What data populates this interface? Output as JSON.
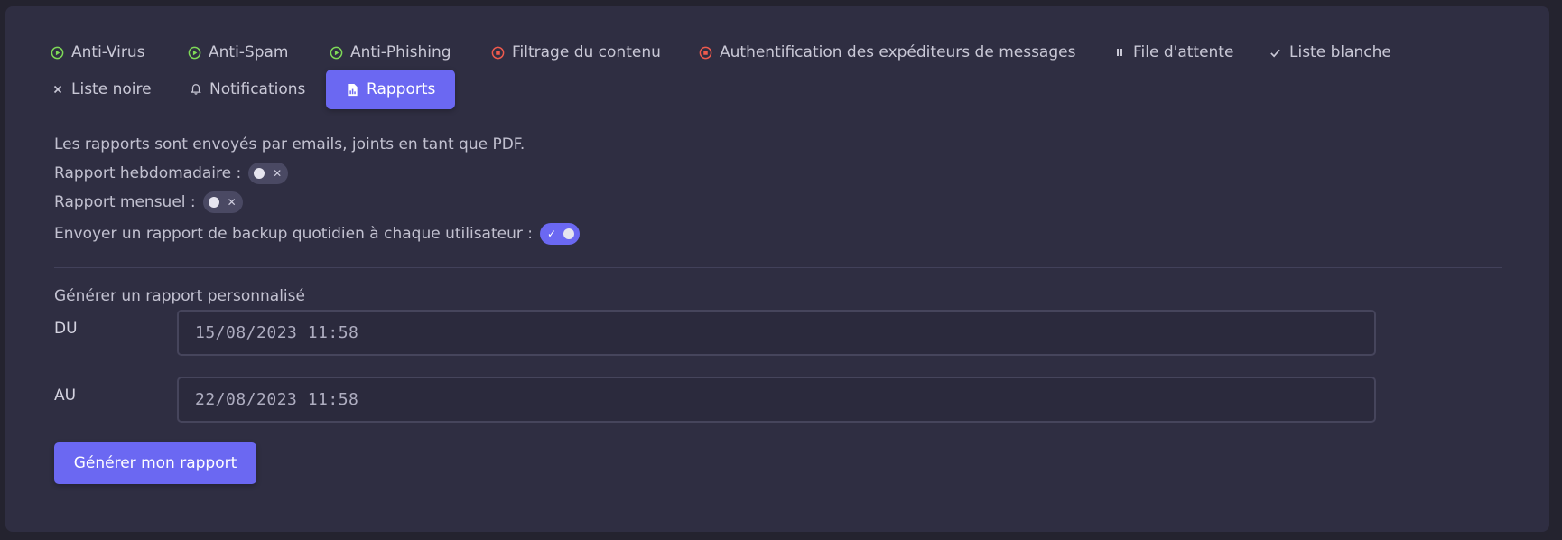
{
  "colors": {
    "accent": "#6b68f2",
    "active_green": "#7ed957",
    "error_red": "#ef5a4d"
  },
  "tabs": {
    "row1": [
      {
        "label": "Anti-Virus",
        "icon": "play-circle-icon"
      },
      {
        "label": "Anti-Spam",
        "icon": "play-circle-icon"
      },
      {
        "label": "Anti-Phishing",
        "icon": "play-circle-icon"
      },
      {
        "label": "Filtrage du contenu",
        "icon": "stop-circle-icon"
      },
      {
        "label": "Authentification des expéditeurs de messages",
        "icon": "stop-circle-icon"
      },
      {
        "label": "File d'attente",
        "icon": "pause-icon"
      },
      {
        "label": "Liste blanche",
        "icon": "check-icon"
      }
    ],
    "row2": [
      {
        "label": "Liste noire",
        "icon": "close-icon"
      },
      {
        "label": "Notifications",
        "icon": "bell-icon"
      },
      {
        "label": "Rapports",
        "icon": "report-file-icon",
        "active": true
      }
    ]
  },
  "reports": {
    "intro": "Les rapports sont envoyés par emails, joints en tant que PDF.",
    "weekly_label": "Rapport hebdomadaire :",
    "weekly_enabled": false,
    "monthly_label": "Rapport mensuel :",
    "monthly_enabled": false,
    "daily_backup_label": "Envoyer un rapport de backup quotidien à chaque utilisateur :",
    "daily_backup_enabled": true,
    "custom_title": "Générer un rapport personnalisé",
    "from_label": "DU",
    "from_value": "15/08/2023 11:58",
    "to_label": "AU",
    "to_value": "22/08/2023 11:58",
    "generate_button": "Générer mon rapport"
  }
}
